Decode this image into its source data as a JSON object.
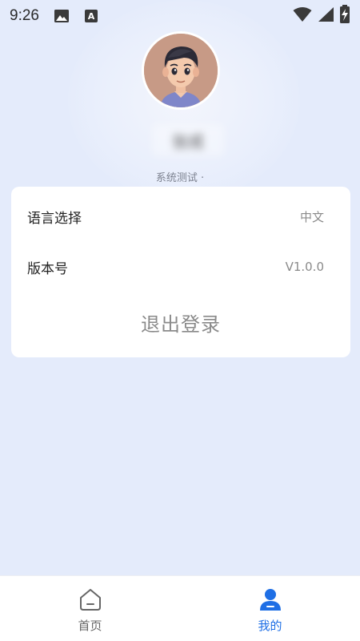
{
  "status_bar": {
    "time": "9:26",
    "left_icons": [
      "image-icon",
      "font-icon"
    ],
    "right_icons": [
      "wifi-icon",
      "signal-icon",
      "battery-charging-icon"
    ]
  },
  "profile": {
    "name": "张成",
    "subtitle": "系统测试 ·"
  },
  "settings": {
    "language_label": "语言选择",
    "language_value": "中文",
    "version_label": "版本号",
    "version_value": "V1.0.0",
    "logout_label": "退出登录"
  },
  "tab_bar": {
    "home_label": "首页",
    "mine_label": "我的",
    "active": "mine",
    "active_color": "#1f6fe5",
    "inactive_color": "#666666"
  }
}
